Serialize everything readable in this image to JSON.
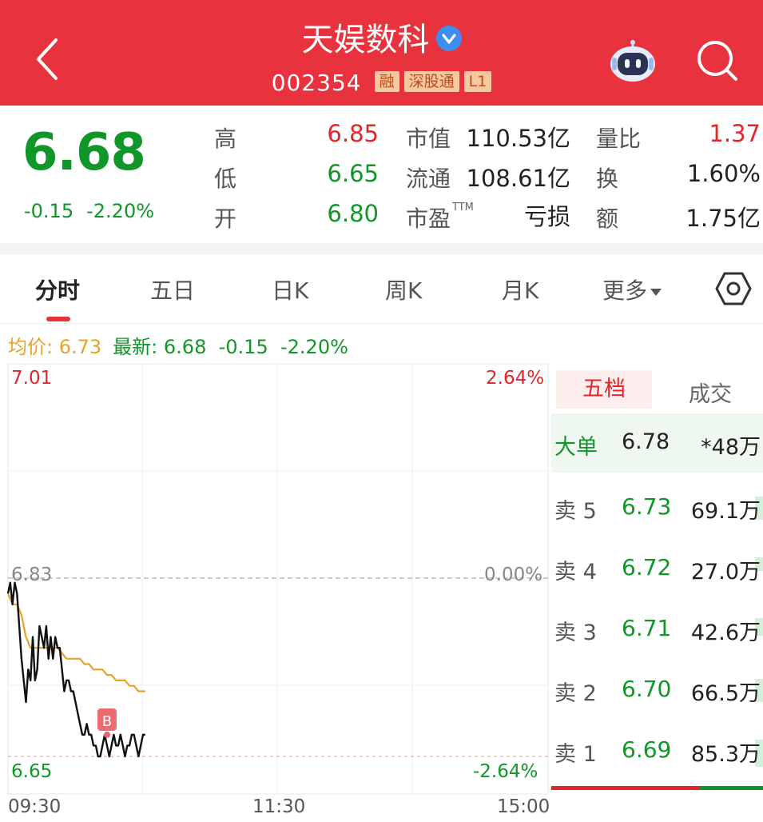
{
  "header": {
    "title": "天娱数科",
    "code": "002354",
    "badges": [
      "融",
      "深股通",
      "L1"
    ]
  },
  "quote": {
    "price": "6.68",
    "change": "-0.15",
    "change_pct": "-2.20%",
    "high_label": "高",
    "high": "6.85",
    "low_label": "低",
    "low": "6.65",
    "open_label": "开",
    "open": "6.80",
    "mktcap_label": "市值",
    "mktcap": "110.53亿",
    "float_label": "流通",
    "float": "108.61亿",
    "pe_label": "市盈",
    "pe_sup": "TTM",
    "pe": "亏损",
    "volratio_label": "量比",
    "volratio": "1.37",
    "turnover_label": "换",
    "turnover": "1.60%",
    "amount_label": "额",
    "amount": "1.75亿"
  },
  "tabs": [
    "分时",
    "五日",
    "日K",
    "周K",
    "月K",
    "更多"
  ],
  "info": {
    "avg_label": "均价:",
    "avg": "6.73",
    "latest_label": "最新:",
    "latest": "6.68",
    "change": "-0.15",
    "change_pct": "-2.20%"
  },
  "chart_labels": {
    "y_top": "7.01",
    "y_mid": "6.83",
    "y_bot": "6.65",
    "pct_top": "2.64%",
    "pct_mid": "0.00%",
    "pct_bot": "-2.64%",
    "t_start": "09:30",
    "t_mid": "11:30",
    "t_end": "15:00",
    "marker": "B"
  },
  "chart_data": {
    "type": "line",
    "ylim": [
      6.65,
      7.01
    ],
    "prev_close": 6.83,
    "x_minutes_total": 240,
    "series": [
      {
        "name": "price",
        "color": "#111111",
        "x": [
          0,
          1,
          2,
          3,
          4,
          5,
          6,
          7,
          8,
          9,
          10,
          11,
          12,
          13,
          14,
          15,
          16,
          17,
          18,
          19,
          20,
          21,
          22,
          23,
          24,
          25,
          26,
          27,
          28,
          29,
          30,
          31,
          32,
          33,
          34,
          35,
          36,
          37,
          38,
          39,
          40,
          41,
          42,
          43,
          44,
          45,
          46,
          47,
          48,
          49,
          50,
          51,
          52,
          53,
          54,
          55,
          56,
          57,
          58,
          59,
          60,
          61
        ],
        "values": [
          6.8,
          6.81,
          6.79,
          6.81,
          6.8,
          6.77,
          6.74,
          6.72,
          6.7,
          6.73,
          6.72,
          6.76,
          6.72,
          6.73,
          6.77,
          6.76,
          6.75,
          6.77,
          6.74,
          6.76,
          6.74,
          6.76,
          6.75,
          6.75,
          6.73,
          6.71,
          6.72,
          6.72,
          6.71,
          6.71,
          6.7,
          6.69,
          6.68,
          6.67,
          6.67,
          6.68,
          6.67,
          6.67,
          6.66,
          6.66,
          6.65,
          6.65,
          6.66,
          6.67,
          6.66,
          6.65,
          6.66,
          6.67,
          6.66,
          6.66,
          6.67,
          6.66,
          6.65,
          6.66,
          6.66,
          6.67,
          6.67,
          6.66,
          6.65,
          6.66,
          6.67,
          6.67
        ]
      },
      {
        "name": "avg",
        "color": "#e8a22a",
        "x": [
          0,
          2,
          4,
          6,
          8,
          10,
          12,
          14,
          16,
          18,
          20,
          22,
          24,
          26,
          28,
          30,
          32,
          34,
          36,
          38,
          40,
          42,
          44,
          46,
          48,
          50,
          52,
          54,
          56,
          58,
          61
        ],
        "values": [
          6.8,
          6.79,
          6.79,
          6.78,
          6.76,
          6.75,
          6.75,
          6.75,
          6.75,
          6.75,
          6.75,
          6.75,
          6.745,
          6.74,
          6.74,
          6.74,
          6.74,
          6.735,
          6.735,
          6.73,
          6.73,
          6.73,
          6.725,
          6.725,
          6.72,
          6.72,
          6.72,
          6.715,
          6.715,
          6.71,
          6.71
        ]
      }
    ]
  },
  "book": {
    "tabs": [
      "五档",
      "成交"
    ],
    "big_order": {
      "label": "大单",
      "price": "6.78",
      "volume": "*48万"
    },
    "asks": [
      {
        "label": "卖 5",
        "price": "6.73",
        "volume": "69.1万",
        "fill": 0.8
      },
      {
        "label": "卖 4",
        "price": "6.72",
        "volume": "27.0万",
        "fill": 0.3
      },
      {
        "label": "卖 3",
        "price": "6.71",
        "volume": "42.6万",
        "fill": 0.5
      },
      {
        "label": "卖 2",
        "price": "6.70",
        "volume": "66.5万",
        "fill": 0.78
      },
      {
        "label": "卖 1",
        "price": "6.69",
        "volume": "85.3万",
        "fill": 1.0
      }
    ]
  }
}
